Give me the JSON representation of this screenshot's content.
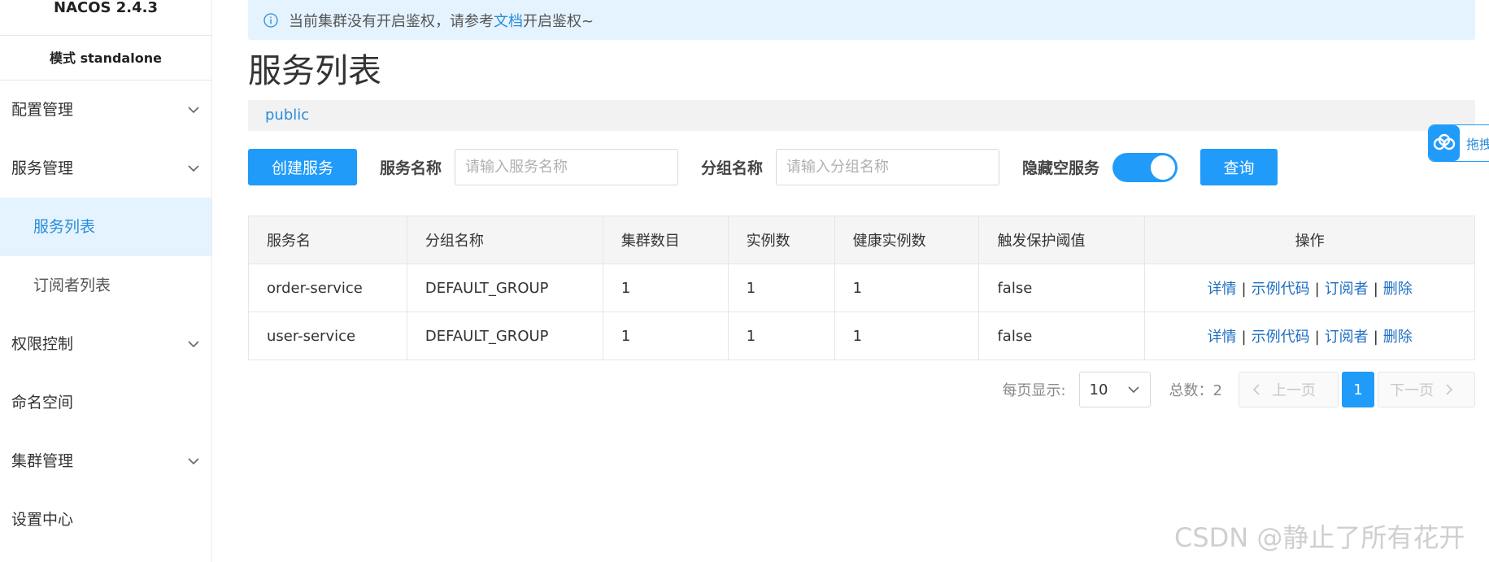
{
  "sidebar": {
    "brand": "NACOS 2.4.3",
    "mode": "模式 standalone",
    "items": [
      {
        "label": "配置管理"
      },
      {
        "label": "服务管理"
      },
      {
        "label": "服务列表"
      },
      {
        "label": "订阅者列表"
      },
      {
        "label": "权限控制"
      },
      {
        "label": "命名空间"
      },
      {
        "label": "集群管理"
      },
      {
        "label": "设置中心"
      }
    ]
  },
  "notice": {
    "text_before": "当前集群没有开启鉴权，请参考",
    "link": "文档",
    "text_after": "开启鉴权~"
  },
  "page": {
    "title": "服务列表",
    "namespace": "public"
  },
  "toolbar": {
    "create_label": "创建服务",
    "service_name_label": "服务名称",
    "service_name_placeholder": "请输入服务名称",
    "group_name_label": "分组名称",
    "group_name_placeholder": "请输入分组名称",
    "hide_empty_label": "隐藏空服务",
    "hide_empty_on": true,
    "search_label": "查询"
  },
  "table": {
    "headers": [
      "服务名",
      "分组名称",
      "集群数目",
      "实例数",
      "健康实例数",
      "触发保护阈值",
      "操作"
    ],
    "rows": [
      {
        "name": "order-service",
        "group": "DEFAULT_GROUP",
        "clusters": "1",
        "instances": "1",
        "healthy": "1",
        "protect": "false"
      },
      {
        "name": "user-service",
        "group": "DEFAULT_GROUP",
        "clusters": "1",
        "instances": "1",
        "healthy": "1",
        "protect": "false"
      }
    ],
    "actions": {
      "detail": "详情",
      "sample": "示例代码",
      "subscribers": "订阅者",
      "delete": "删除",
      "sep": "|"
    }
  },
  "pager": {
    "page_size_label": "每页显示:",
    "page_size": "10",
    "total_label": "总数：2",
    "prev": "上一页",
    "current": "1",
    "next": "下一页"
  },
  "float_widget": {
    "label": "拖拽"
  },
  "watermark": "CSDN @静止了所有花开",
  "colors": {
    "primary": "#209bfa",
    "link": "#2a8dd9",
    "active_bg": "#e5f3ff"
  }
}
